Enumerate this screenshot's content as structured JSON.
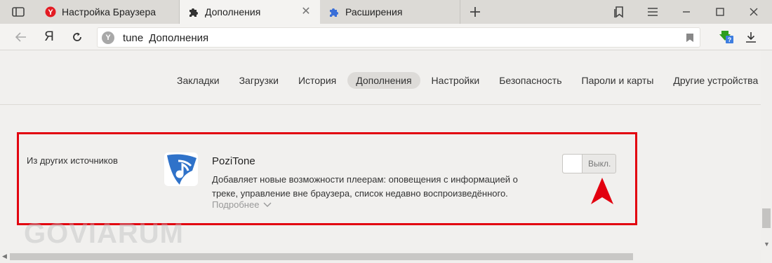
{
  "tabs": [
    {
      "label": "Настройка Браузера",
      "icon": "yandex-icon"
    },
    {
      "label": "Дополнения",
      "icon": "puzzle-icon"
    },
    {
      "label": "Расширения",
      "icon": "puzzle-icon"
    }
  ],
  "address": {
    "site_badge": "Y",
    "text": "tune",
    "subtext": "Дополнения"
  },
  "nav": {
    "home_label": "Я"
  },
  "settings_nav": {
    "items": [
      "Закладки",
      "Загрузки",
      "История",
      "Дополнения",
      "Настройки",
      "Безопасность",
      "Пароли и карты",
      "Другие устройства"
    ],
    "active": "Дополнения"
  },
  "section": {
    "label": "Из других источников"
  },
  "extension": {
    "name": "PoziTone",
    "description": "Добавляет новые возможности плеерам: оповещения с информацией о треке, управление вне браузера, список недавно воспроизведённого.",
    "more_label": "Подробнее",
    "toggle_label": "Выкл.",
    "enabled": false
  },
  "watermark": "GOVIARUM",
  "colors": {
    "highlight": "#e2000f",
    "tab_active_bg": "#f4f3f1",
    "tabstrip_bg": "#dcdad6",
    "page_bg": "#f1f0ee",
    "brand_red": "#e31b23",
    "extension_icon": "#2f72c9"
  }
}
